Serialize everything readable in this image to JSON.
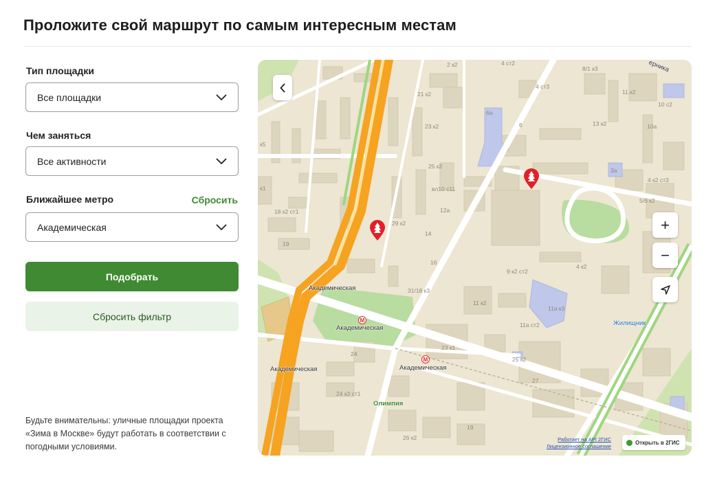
{
  "page": {
    "title": "Проложите свой маршрут по самым интересным местам"
  },
  "filters": {
    "type": {
      "label": "Тип площадки",
      "value": "Все площадки"
    },
    "activity": {
      "label": "Чем заняться",
      "value": "Все активности"
    },
    "metro": {
      "label": "Ближайшее метро",
      "value": "Академическая",
      "reset_label": "Сбросить"
    }
  },
  "actions": {
    "submit_label": "Подобрать",
    "reset_label": "Сбросить фильтр"
  },
  "note": "Будьте внимательны: уличные площадки проекта «Зима в Москве» будут работать в соответствии с погодными условиями.",
  "map": {
    "controls": {
      "zoom_in": "+",
      "zoom_out": "−"
    },
    "attribution": {
      "line1": "Работает на API 2ГИС",
      "line2": "Лицензионное соглашение"
    },
    "open_label": "Открыть в 2ГИС",
    "labels": {
      "metro1": "Академическая",
      "metro2": "Академическая",
      "metro3": "Академическая",
      "metro4": "Академическая",
      "olimpia": "Олимпия",
      "zhilishnik": "Жилищник",
      "street": "ерника"
    },
    "houses": {
      "h1": "2 к2",
      "h2": "4 ст2",
      "h3": "8/1 к3",
      "h4": "21 к2",
      "h5": "6а",
      "h6": "4 ст3",
      "h7": "11 к2",
      "h8": "10 с2",
      "h9": "23 к2",
      "h10": "6",
      "h11": "13 к2",
      "h12": "10а",
      "h13": "25 к2",
      "h14": "вл10 с11",
      "h15": "3а",
      "h16": "4 к2 ст3",
      "h17": "18 к2 ст1",
      "h18": "12а",
      "h19": "5/6 к2",
      "h20": "29 к2",
      "h21": "14",
      "h22": "19",
      "h23": "16",
      "h24": "9 к2 ст2",
      "h25": "4 к2",
      "h26": "31/18 к3",
      "h27": "11 к2",
      "h28": "11а к3",
      "h29": "11а ст2",
      "h30": "23 к1",
      "h31": "25 к2",
      "h32": "24",
      "h33": "24 к3 ст1",
      "h34": "27",
      "h35": "26 к2",
      "h36": "19",
      "h37": "к5",
      "h38": "к1"
    },
    "colors": {
      "accent": "#3f8a32",
      "marker": "#e0202a",
      "metro": "#d62b2b"
    }
  }
}
